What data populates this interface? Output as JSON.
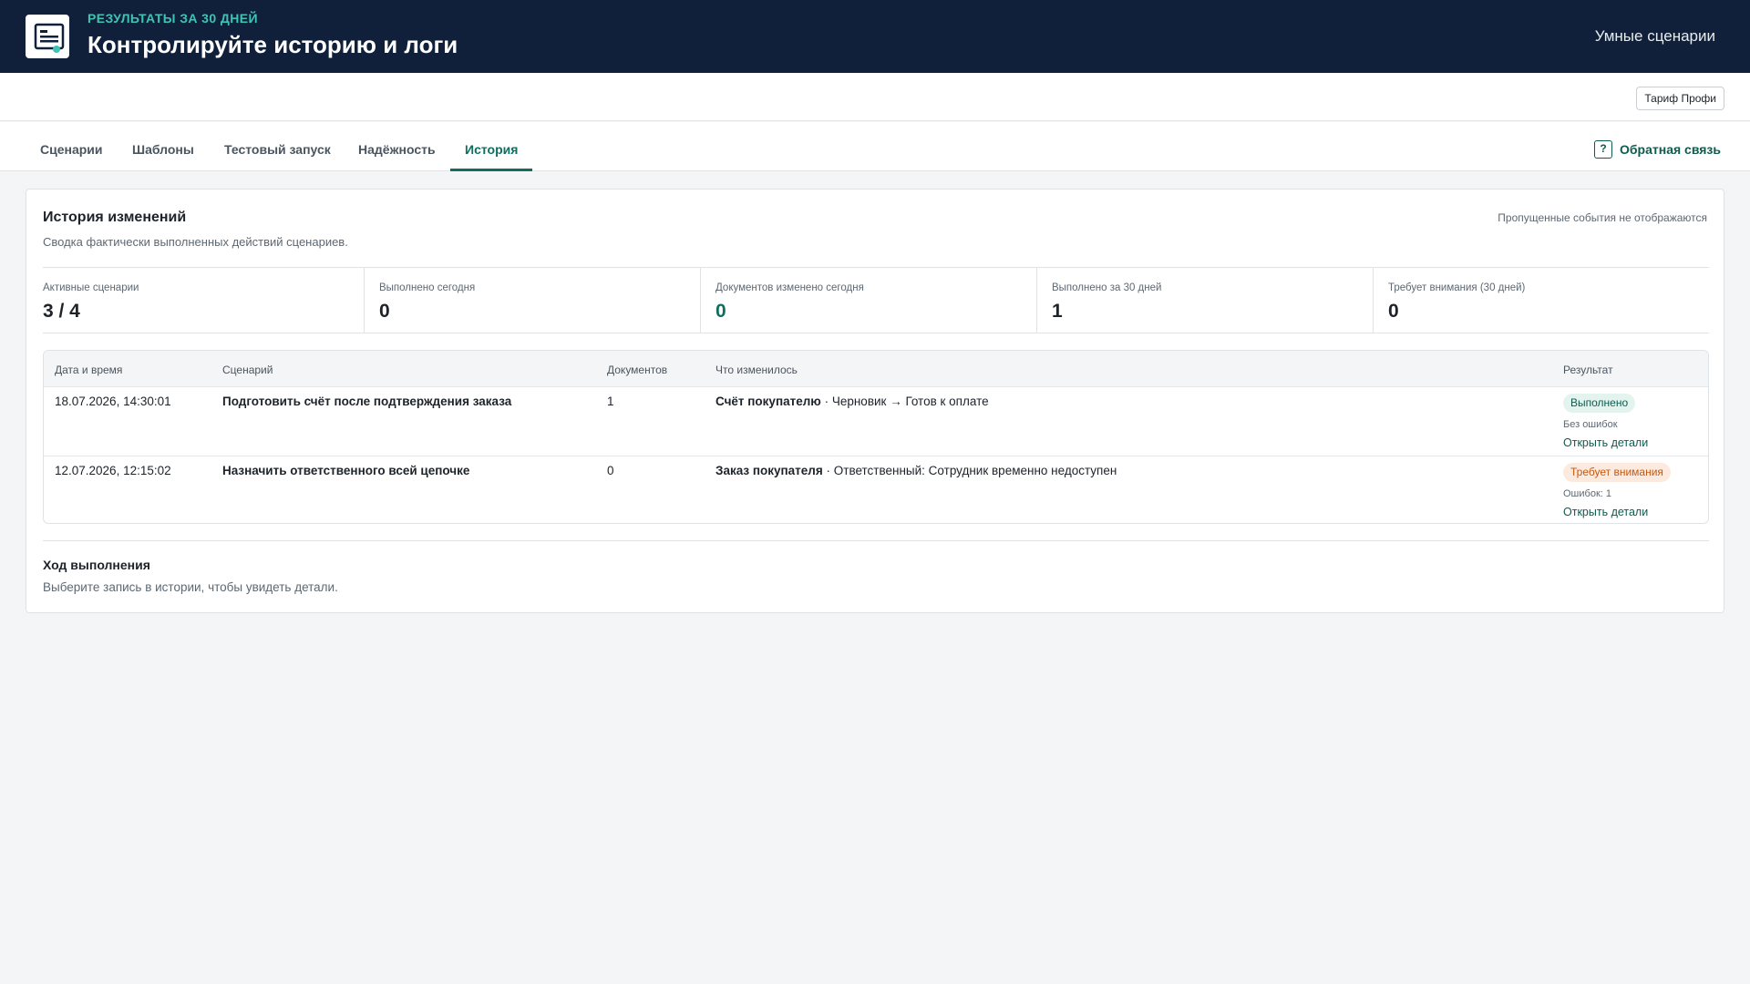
{
  "header": {
    "kicker": "РЕЗУЛЬТАТЫ ЗА 30 ДНЕЙ",
    "title": "Контролируйте историю и логи",
    "right_link": "Умные сценарии"
  },
  "tariff": {
    "label": "Тариф Профи"
  },
  "tabs": [
    {
      "label": "Сценарии"
    },
    {
      "label": "Шаблоны"
    },
    {
      "label": "Тестовый запуск"
    },
    {
      "label": "Надёжность"
    },
    {
      "label": "История",
      "active": true
    }
  ],
  "feedback": {
    "icon": "?",
    "label": "Обратная связь"
  },
  "history": {
    "title": "История изменений",
    "subtitle": "Сводка фактически выполненных действий сценариев.",
    "note": "Пропущенные события не отображаются",
    "stats": [
      {
        "label": "Активные сценарии",
        "value": "3 / 4"
      },
      {
        "label": "Выполнено сегодня",
        "value": "0"
      },
      {
        "label": "Документов изменено сегодня",
        "value": "0"
      },
      {
        "label": "Выполнено за 30 дней",
        "value": "1"
      },
      {
        "label": "Требует внимания (30 дней)",
        "value": "0"
      }
    ],
    "columns": [
      "Дата и время",
      "Сценарий",
      "Документов",
      "Что изменилось",
      "Результат"
    ],
    "rows": [
      {
        "datetime": "18.07.2026, 14:30:01",
        "scenario": "Подготовить счёт после подтверждения заказа",
        "documents": "1",
        "change_doc": "Счёт покупателю",
        "change_text": " · Черновик → Готов к оплате",
        "result_status": "Выполнено",
        "result_note": "Без ошибок",
        "result_link": "Открыть детали"
      },
      {
        "datetime": "12.07.2026, 12:15:02",
        "scenario": "Назначить ответственного всей цепочке",
        "documents": "0",
        "change_doc": "Заказ покупателя",
        "change_text": " · Ответственный: Сотрудник временно недоступен",
        "result_status": "Требует внимания",
        "result_note": "Ошибок: 1",
        "result_link": "Открыть детали"
      }
    ]
  },
  "progress": {
    "title": "Ход выполнения",
    "subtitle": "Выберите запись в истории, чтобы увидеть детали."
  },
  "colors": {
    "header_bg": "#10203a",
    "kicker": "#3fc4b3",
    "accent": "#0f6e5f",
    "warn": "#c45a12"
  }
}
